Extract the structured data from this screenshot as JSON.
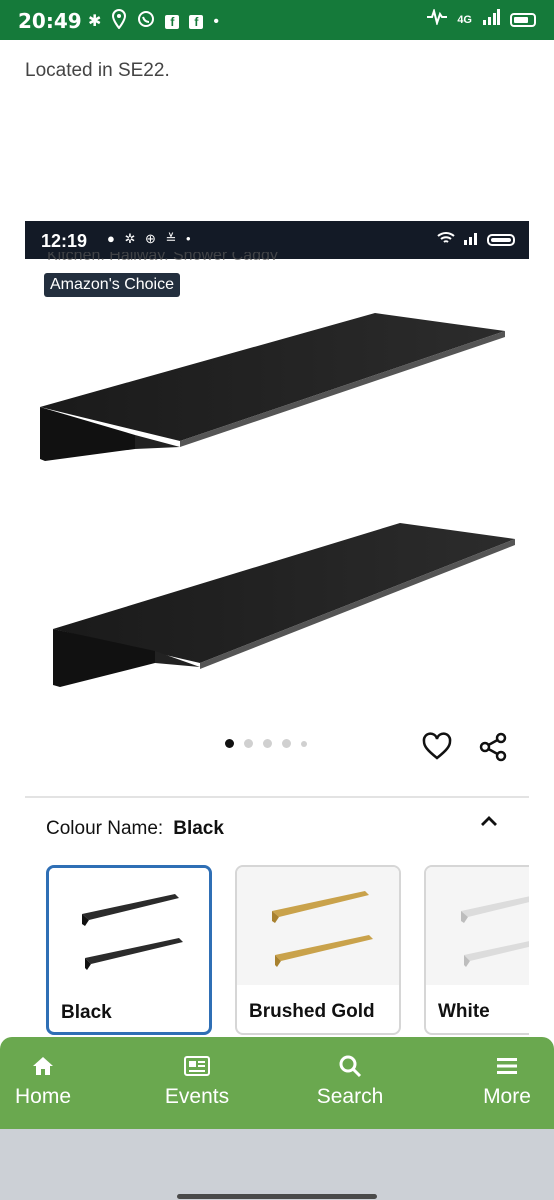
{
  "status_bar": {
    "time": "20:49",
    "network": "4G",
    "icons": [
      "bluetooth-icon",
      "location-pin-icon",
      "whatsapp-icon",
      "facebook-icon",
      "facebook-icon",
      "dot-icon",
      "activity-icon",
      "signal-icon",
      "battery-icon"
    ]
  },
  "location_text": "Located in SE22.",
  "embedded_screenshot": {
    "status_time": "12:19",
    "cut_text": "Kitchen, Hallway, Shower Caddy",
    "badge": "Amazon's Choice",
    "carousel": {
      "total": 5,
      "active": 1
    },
    "colour_label": "Colour Name:",
    "colour_value": "Black",
    "swatches": [
      {
        "label": "Black",
        "color": "#2b2b2b",
        "selected": true
      },
      {
        "label": "Brushed Gold",
        "color": "#c9a24b",
        "selected": false
      },
      {
        "label": "White",
        "color": "#d9d9d9",
        "selected": false
      }
    ]
  },
  "bottom_nav": {
    "items": [
      {
        "label": "Home",
        "icon": "home-icon"
      },
      {
        "label": "Events",
        "icon": "newspaper-icon"
      },
      {
        "label": "Search",
        "icon": "search-icon"
      },
      {
        "label": "More",
        "icon": "menu-icon"
      }
    ],
    "color": "#6aa84f"
  },
  "colors": {
    "status_bar": "#157a3a",
    "selected_border": "#2f6fb5"
  }
}
